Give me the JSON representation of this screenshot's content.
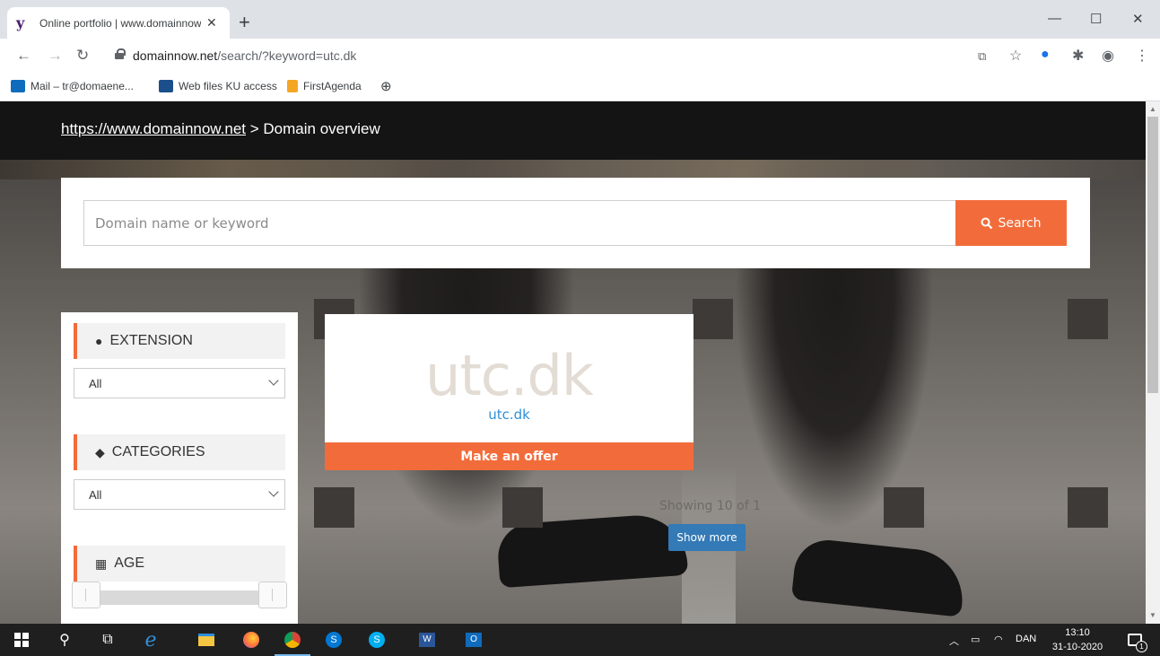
{
  "browser": {
    "tab_title": "Online portfolio | www.domainnow.net",
    "tab_close": "✕",
    "new_tab": "+",
    "url_host": "domainnow.net",
    "url_path": "/search/?keyword=utc.dk",
    "window_controls": [
      "—",
      "☐",
      "✕"
    ]
  },
  "bookmarks": [
    {
      "label": "Mail – tr@domaene...",
      "icon": "outlook-icon",
      "color": "#0f6cbd"
    },
    {
      "label": "Web files KU access",
      "icon": "ku-icon",
      "color": "#1a4f8b"
    },
    {
      "label": "FirstAgenda",
      "icon": "firstagenda-icon",
      "color": "#f5a623"
    }
  ],
  "site": {
    "breadcrumb_link": "https://www.domainnow.net",
    "breadcrumb_sep": " > ",
    "breadcrumb_current": "Domain overview",
    "search_placeholder": "Domain name or keyword",
    "search_button": "Search",
    "accent": "#f26c3b"
  },
  "filters": {
    "extension_label": "EXTENSION",
    "extension_value": "All",
    "categories_label": "CATEGORIES",
    "categories_value": "All",
    "age_label": "AGE"
  },
  "result": {
    "logo_text": "utc.dk",
    "domain": "utc.dk",
    "offer_button": "Make an offer"
  },
  "pagination": {
    "showing": "Showing 10 of 1",
    "show_more": "Show more"
  },
  "taskbar": {
    "language": "DAN",
    "time": "13:10",
    "date": "31-10-2020",
    "notifications": "1"
  }
}
